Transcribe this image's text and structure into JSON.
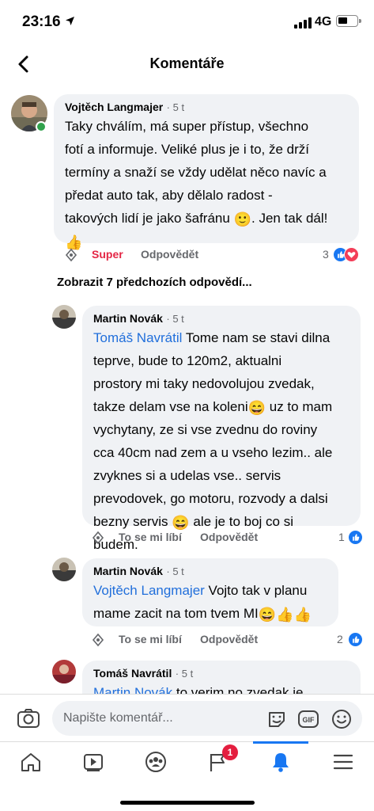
{
  "status": {
    "time": "23:16",
    "network": "4G"
  },
  "header": {
    "title": "Komentáře"
  },
  "comments": [
    {
      "author": "Vojtěch Langmajer",
      "time": "5 t",
      "text_1": "Taky chválím, má super přístup, všechno",
      "text_2": "fotí a informuje. Veliké plus je i to, že drží",
      "text_3": "termíny a snaží se vždy udělat něco navíc a",
      "text_4": "předat auto tak, aby dělalo radost -",
      "text_5": "takových lidí je jako šafránu",
      "text_6": ". Jen tak dál!",
      "reaction_label": "Super",
      "reply_label": "Odpovědět",
      "reaction_count": "3"
    }
  ],
  "show_previous": "Zobrazit 7 předchozích odpovědí...",
  "replies": [
    {
      "author": "Martin Novák",
      "time": "5 t",
      "mention": "Tomáš Navrátil",
      "text_1": " Tome nam se stavi dilna",
      "text_2": "teprve, bude to 120m2, aktualni",
      "text_3": "prostory mi taky nedovolujou zvedak,",
      "text_4": "takze delam vse na koleni",
      "text_4b": " uz to mam",
      "text_5": "vychytany, ze si vse zvednu do roviny",
      "text_6": "cca 40cm nad zem a u vseho lezim.. ale",
      "text_7": "zvyknes si a udelas vse.. servis",
      "text_8": "prevodovek, go motoru, rozvody a dalsi",
      "text_9": "bezny servis",
      "text_9b": " ale je to boj co si",
      "text_10": "budem.",
      "like_label": "To se mi líbí",
      "reply_label": "Odpovědět",
      "reaction_count": "1"
    },
    {
      "author": "Martin Novák",
      "time": "5 t",
      "mention": "Vojtěch Langmajer",
      "text_1": " Vojto tak v planu",
      "text_2": "mame zacit na tom tvem MI",
      "like_label": "To se mi líbí",
      "reply_label": "Odpovědět",
      "reaction_count": "2"
    },
    {
      "author": "Tomáš Navrátil",
      "time": "5 t",
      "mention": "Martin Novák",
      "text_1": " to verim no zvedak je"
    }
  ],
  "composer": {
    "placeholder": "Napište komentář..."
  },
  "tabbar": {
    "notifications_badge": "1"
  },
  "emojis": {
    "smile": "🙂",
    "thumbs_up": "👍",
    "grin": "😄"
  },
  "colors": {
    "accent": "#1877f2",
    "mention": "#216fdb",
    "super_reaction": "#e42645",
    "bubble": "#f0f2f5"
  },
  "icons": [
    "back-arrow-icon",
    "location-arrow-icon",
    "signal-icon",
    "battery-icon",
    "super-reaction-icon",
    "like-badge-icon",
    "love-badge-icon",
    "camera-icon",
    "sticker-icon",
    "gif-icon",
    "emoji-icon",
    "home-icon",
    "video-icon",
    "groups-icon",
    "pages-flag-icon",
    "bell-icon",
    "menu-icon"
  ]
}
